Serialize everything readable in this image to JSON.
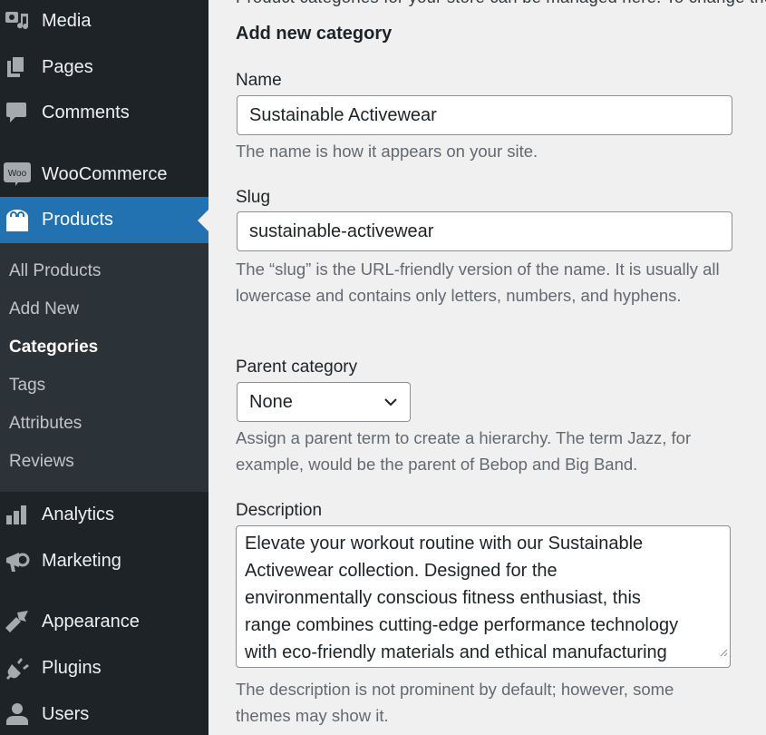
{
  "sidebar": {
    "items": [
      {
        "label": "Media",
        "icon": "media-icon"
      },
      {
        "label": "Pages",
        "icon": "pages-icon"
      },
      {
        "label": "Comments",
        "icon": "comments-icon"
      },
      {
        "label": "WooCommerce",
        "icon": "woocommerce-icon"
      },
      {
        "label": "Products",
        "icon": "products-icon",
        "active": true
      },
      {
        "label": "Analytics",
        "icon": "analytics-icon"
      },
      {
        "label": "Marketing",
        "icon": "marketing-icon"
      },
      {
        "label": "Appearance",
        "icon": "appearance-icon"
      },
      {
        "label": "Plugins",
        "icon": "plugins-icon"
      },
      {
        "label": "Users",
        "icon": "users-icon"
      }
    ],
    "submenu": [
      {
        "label": "All Products"
      },
      {
        "label": "Add New"
      },
      {
        "label": "Categories",
        "current": true
      },
      {
        "label": "Tags"
      },
      {
        "label": "Attributes"
      },
      {
        "label": "Reviews"
      }
    ],
    "woo_badge": "Woo"
  },
  "main": {
    "partial_top_text": "Product categories for your store can be managed here. To change the order of categories on the front-end you can drag and drop to sort them. To see more categories listed click the \"screen options\" link at the top-right of this page.",
    "heading": "Add new category",
    "name": {
      "label": "Name",
      "value": "Sustainable Activewear",
      "help": "The name is how it appears on your site."
    },
    "slug": {
      "label": "Slug",
      "value": "sustainable-activewear",
      "help": "The “slug” is the URL-friendly version of the name. It is usually all lowercase and contains only letters, numbers, and hyphens."
    },
    "parent": {
      "label": "Parent category",
      "selected": "None",
      "help": "Assign a parent term to create a hierarchy. The term Jazz, for example, would be the parent of Bebop and Big Band."
    },
    "description": {
      "label": "Description",
      "lines": [
        "Elevate your workout routine with our Sustainable",
        "Activewear collection. Designed for the",
        "environmentally conscious fitness enthusiast, this",
        "range combines cutting-edge performance technology",
        "with eco-friendly materials and ethical manufacturing"
      ],
      "help": "The description is not prominent by default; however, some themes may show it."
    }
  },
  "colors": {
    "sidebar_bg": "#1d2327",
    "submenu_bg": "#2c3338",
    "accent": "#2271b1",
    "page_bg": "#f0f0f1",
    "help_text": "#646970"
  }
}
